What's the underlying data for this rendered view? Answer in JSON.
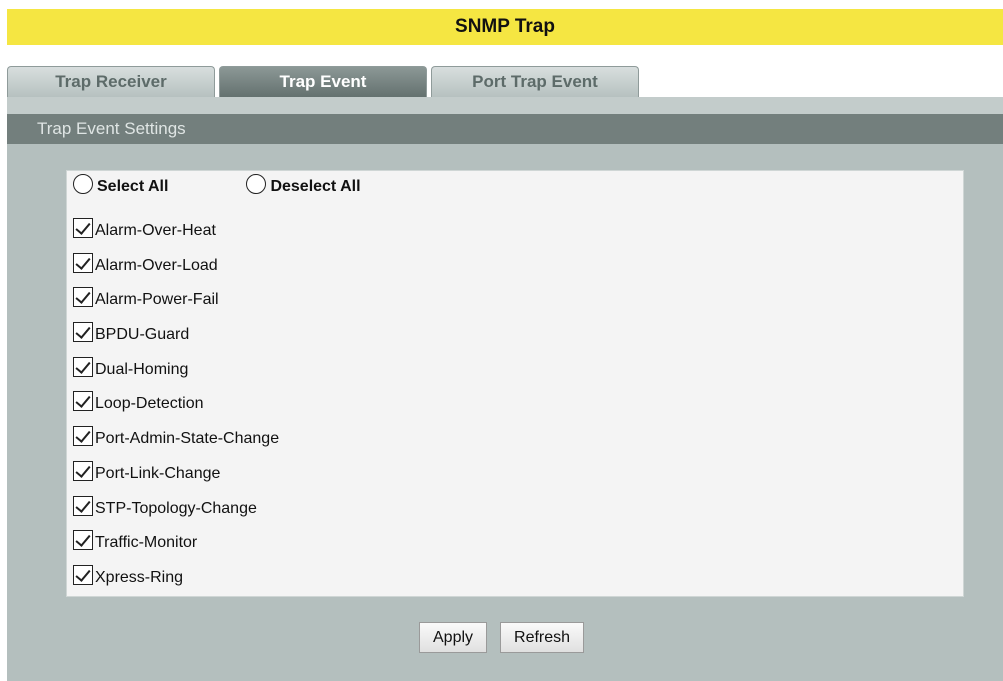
{
  "page": {
    "title": "SNMP Trap"
  },
  "tabs": [
    {
      "label": "Trap Receiver",
      "active": false
    },
    {
      "label": "Trap Event",
      "active": true
    },
    {
      "label": "Port Trap Event",
      "active": false
    }
  ],
  "section": {
    "title": "Trap Event Settings"
  },
  "select_controls": {
    "select_all": "Select All",
    "deselect_all": "Deselect All"
  },
  "events": [
    {
      "label": "Alarm-Over-Heat",
      "checked": true
    },
    {
      "label": "Alarm-Over-Load",
      "checked": true
    },
    {
      "label": "Alarm-Power-Fail",
      "checked": true
    },
    {
      "label": "BPDU-Guard",
      "checked": true
    },
    {
      "label": "Dual-Homing",
      "checked": true
    },
    {
      "label": "Loop-Detection",
      "checked": true
    },
    {
      "label": "Port-Admin-State-Change",
      "checked": true
    },
    {
      "label": "Port-Link-Change",
      "checked": true
    },
    {
      "label": "STP-Topology-Change",
      "checked": true
    },
    {
      "label": "Traffic-Monitor",
      "checked": true
    },
    {
      "label": "Xpress-Ring",
      "checked": true
    }
  ],
  "buttons": {
    "apply": "Apply",
    "refresh": "Refresh"
  },
  "colors": {
    "title_bar": "#f5e642",
    "active_tab": "#64716f",
    "section_header": "#737f7d",
    "panel": "#b4bfbe"
  }
}
